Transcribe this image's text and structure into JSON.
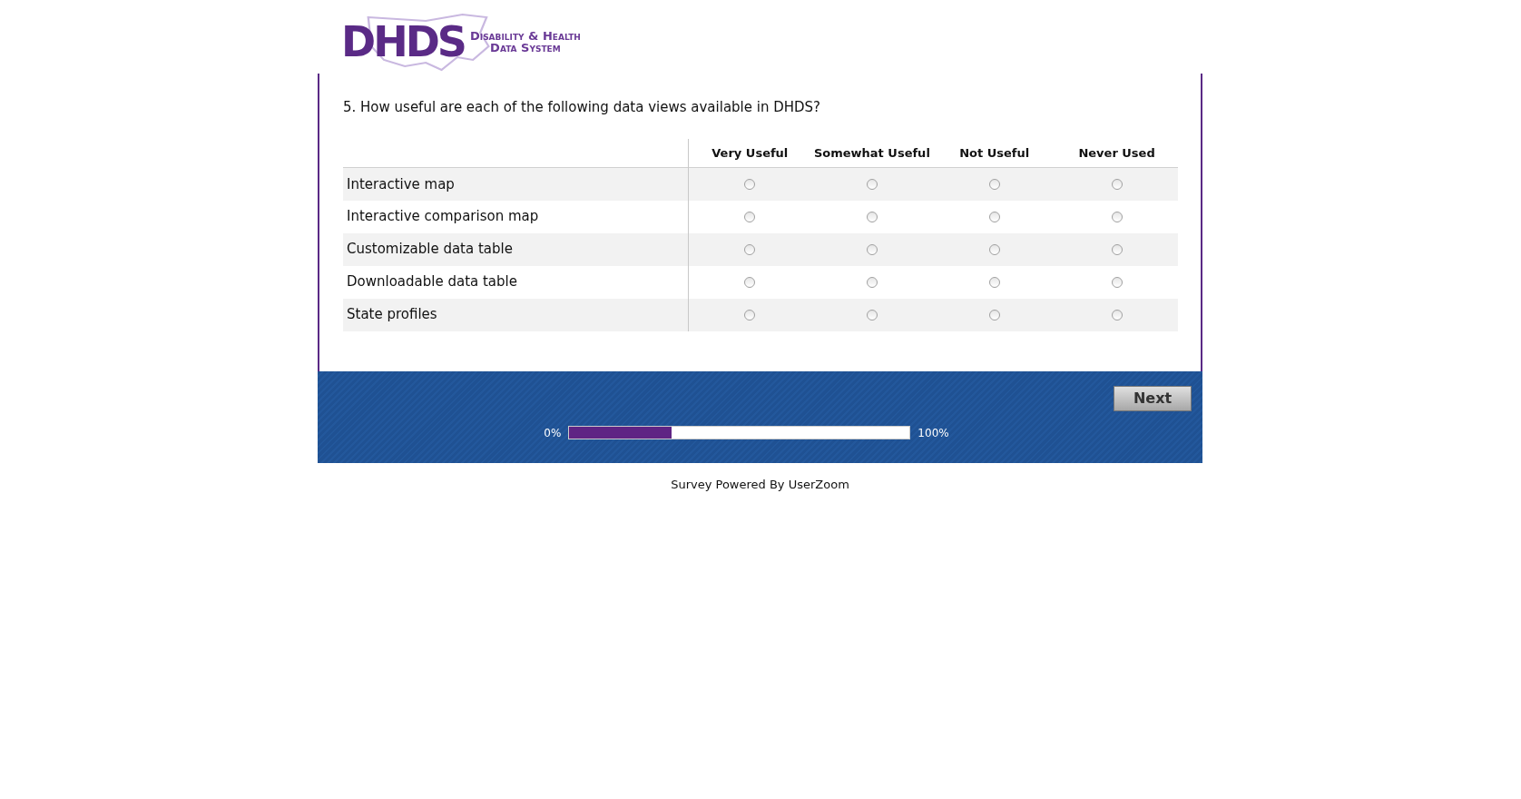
{
  "logo": {
    "mark": "DHDS",
    "name_line_1": "Disability & Health",
    "name_line_2": "Data System"
  },
  "question": "5. How useful are each of the following data views available in DHDS?",
  "columns": [
    "Very Useful",
    "Somewhat Useful",
    "Not Useful",
    "Never Used"
  ],
  "rows": [
    {
      "label": "Interactive map",
      "options": [
        {
          "selected": false
        },
        {
          "selected": false
        },
        {
          "selected": false
        },
        {
          "selected": false
        }
      ]
    },
    {
      "label": "Interactive comparison map",
      "options": [
        {
          "selected": false
        },
        {
          "selected": false
        },
        {
          "selected": false
        },
        {
          "selected": false
        }
      ]
    },
    {
      "label": "Customizable data table",
      "options": [
        {
          "selected": false
        },
        {
          "selected": false
        },
        {
          "selected": false
        },
        {
          "selected": false
        }
      ]
    },
    {
      "label": "Downloadable data table",
      "options": [
        {
          "selected": false
        },
        {
          "selected": false
        },
        {
          "selected": false
        },
        {
          "selected": false
        }
      ]
    },
    {
      "label": "State profiles",
      "options": [
        {
          "selected": false
        },
        {
          "selected": false
        },
        {
          "selected": false
        },
        {
          "selected": false
        }
      ]
    }
  ],
  "next_button": "Next",
  "progress": {
    "start_label": "0%",
    "end_label": "100%",
    "level": 0.3
  },
  "footer": "Survey Powered By UserZoom"
}
